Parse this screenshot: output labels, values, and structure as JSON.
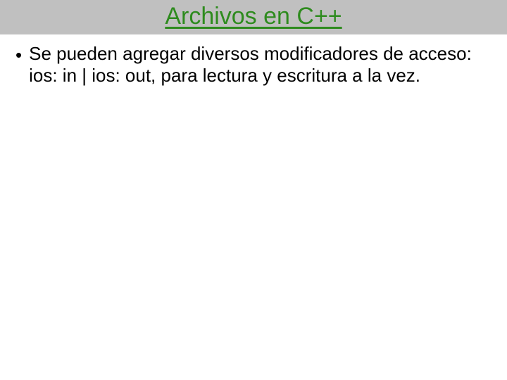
{
  "slide": {
    "title": "Archivos en C++",
    "bullets": [
      {
        "text": "Se pueden agregar diversos modificadores de acceso: ios: in | ios: out, para lectura y escritura a la vez."
      }
    ]
  }
}
